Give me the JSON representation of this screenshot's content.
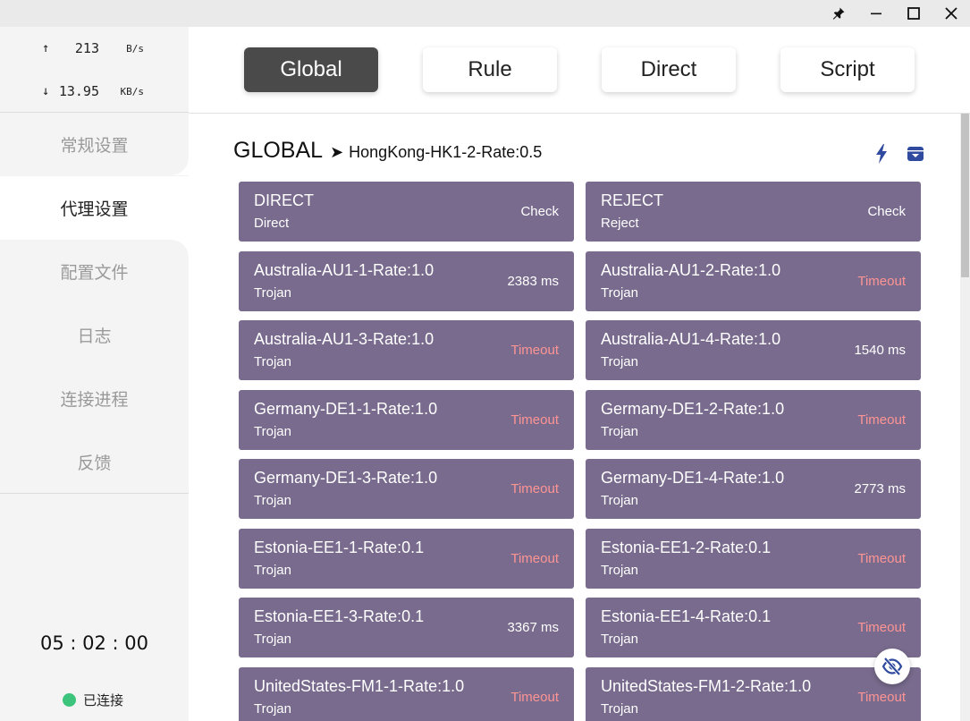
{
  "window": {
    "pin_icon": "pin-icon",
    "minimize_icon": "minimize-icon",
    "maximize_icon": "maximize-icon",
    "close_icon": "close-icon"
  },
  "traffic": {
    "up_arrow": "↑",
    "up_value": "213",
    "up_unit": "B/s",
    "down_arrow": "↓",
    "down_value": "13.95",
    "down_unit": "KB/s"
  },
  "sidebar": {
    "items": [
      {
        "label": "常规设置"
      },
      {
        "label": "代理设置"
      },
      {
        "label": "配置文件"
      },
      {
        "label": "日志"
      },
      {
        "label": "连接进程"
      },
      {
        "label": "反馈"
      }
    ],
    "active_index": 1,
    "clock": "05 : 02 : 00",
    "status_label": "已连接",
    "status_color": "#3cc47c"
  },
  "modes": {
    "items": [
      {
        "label": "Global"
      },
      {
        "label": "Rule"
      },
      {
        "label": "Direct"
      },
      {
        "label": "Script"
      }
    ],
    "active": "Global"
  },
  "group": {
    "name": "GLOBAL",
    "separator": "➤",
    "current": "HongKong-HK1-2-Rate:0.5",
    "actions": [
      "bolt-icon",
      "archive-icon"
    ]
  },
  "proxies": [
    {
      "name": "DIRECT",
      "type": "Direct",
      "delay": "Check",
      "timeout": false
    },
    {
      "name": "REJECT",
      "type": "Reject",
      "delay": "Check",
      "timeout": false
    },
    {
      "name": "Australia-AU1-1-Rate:1.0",
      "type": "Trojan",
      "delay": "2383 ms",
      "timeout": false
    },
    {
      "name": "Australia-AU1-2-Rate:1.0",
      "type": "Trojan",
      "delay": "Timeout",
      "timeout": true
    },
    {
      "name": "Australia-AU1-3-Rate:1.0",
      "type": "Trojan",
      "delay": "Timeout",
      "timeout": true
    },
    {
      "name": "Australia-AU1-4-Rate:1.0",
      "type": "Trojan",
      "delay": "1540 ms",
      "timeout": false
    },
    {
      "name": "Germany-DE1-1-Rate:1.0",
      "type": "Trojan",
      "delay": "Timeout",
      "timeout": true
    },
    {
      "name": "Germany-DE1-2-Rate:1.0",
      "type": "Trojan",
      "delay": "Timeout",
      "timeout": true
    },
    {
      "name": "Germany-DE1-3-Rate:1.0",
      "type": "Trojan",
      "delay": "Timeout",
      "timeout": true
    },
    {
      "name": "Germany-DE1-4-Rate:1.0",
      "type": "Trojan",
      "delay": "2773 ms",
      "timeout": false
    },
    {
      "name": "Estonia-EE1-1-Rate:0.1",
      "type": "Trojan",
      "delay": "Timeout",
      "timeout": true
    },
    {
      "name": "Estonia-EE1-2-Rate:0.1",
      "type": "Trojan",
      "delay": "Timeout",
      "timeout": true
    },
    {
      "name": "Estonia-EE1-3-Rate:0.1",
      "type": "Trojan",
      "delay": "3367 ms",
      "timeout": false
    },
    {
      "name": "Estonia-EE1-4-Rate:0.1",
      "type": "Trojan",
      "delay": "Timeout",
      "timeout": true
    },
    {
      "name": "UnitedStates-FM1-1-Rate:1.0",
      "type": "Trojan",
      "delay": "Timeout",
      "timeout": true
    },
    {
      "name": "UnitedStates-FM1-2-Rate:1.0",
      "type": "Trojan",
      "delay": "Timeout",
      "timeout": true
    }
  ],
  "colors": {
    "card_bg": "#786b8d",
    "timeout": "#ff9494",
    "accent_icon": "#2f4a9e",
    "active_mode": "#4a4a4a"
  },
  "floating": {
    "icon": "eye-off-icon"
  }
}
